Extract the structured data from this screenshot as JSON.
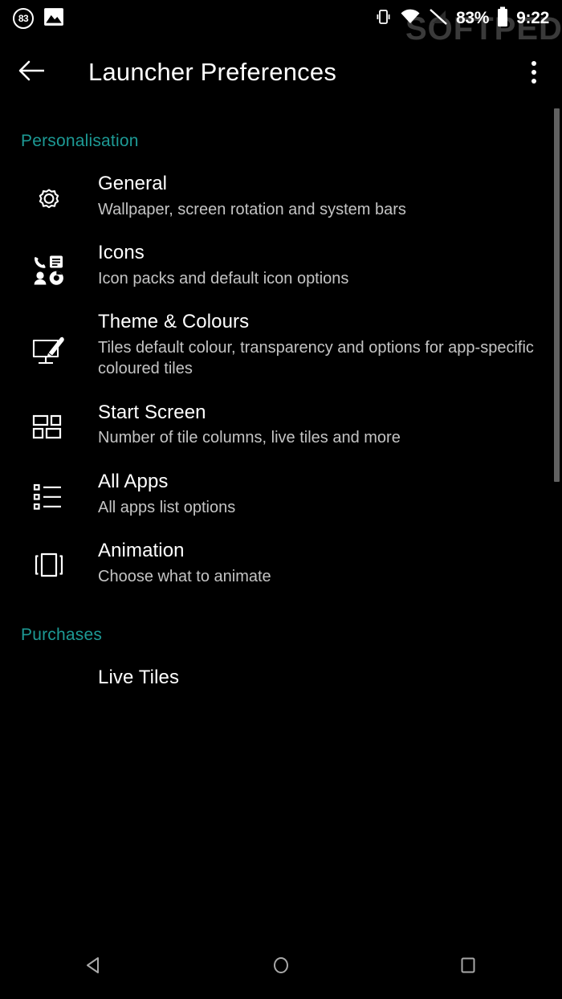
{
  "status_bar": {
    "notification_badge": "83",
    "icons_left": [
      "counter-badge-icon",
      "image-icon"
    ],
    "icons_right": [
      "vibrate-icon",
      "wifi-icon",
      "signal-off-icon",
      "battery-icon"
    ],
    "battery_percent": "83%",
    "clock": "9:22"
  },
  "watermark": {
    "text": "SOFTPEDIA",
    "mark": "®"
  },
  "app_bar": {
    "back_icon": "arrow-left-icon",
    "title": "Launcher Preferences",
    "overflow_icon": "more-vertical-icon"
  },
  "colors": {
    "background": "#000000",
    "accent_teal": "#1d9a95",
    "title_text": "#ffffff",
    "subtitle_text": "#c4c4c4",
    "scrollbar": "#616161",
    "nav_icon": "#a8a8a8",
    "watermark": "#3a3a3a"
  },
  "sections": [
    {
      "header": "Personalisation",
      "items": [
        {
          "icon": "gear-icon",
          "title": "General",
          "subtitle": "Wallpaper, screen rotation and system bars"
        },
        {
          "icon": "app-icons-grid-icon",
          "title": "Icons",
          "subtitle": "Icon packs and default icon options"
        },
        {
          "icon": "monitor-paintbrush-icon",
          "title": "Theme & Colours",
          "subtitle": "Tiles default colour, transparency and options for app-specific coloured tiles"
        },
        {
          "icon": "tiles-layout-icon",
          "title": "Start Screen",
          "subtitle": "Number of tile columns, live tiles and more"
        },
        {
          "icon": "list-icon",
          "title": "All Apps",
          "subtitle": "All apps list options"
        },
        {
          "icon": "animation-slide-icon",
          "title": "Animation",
          "subtitle": "Choose what to animate"
        }
      ]
    },
    {
      "header": "Purchases",
      "items": [
        {
          "icon": "",
          "title": "Live Tiles",
          "subtitle": ""
        }
      ]
    }
  ],
  "nav_bar": {
    "back_label": "back-triangle-icon",
    "home_label": "home-circle-icon",
    "recents_label": "recents-square-icon"
  }
}
